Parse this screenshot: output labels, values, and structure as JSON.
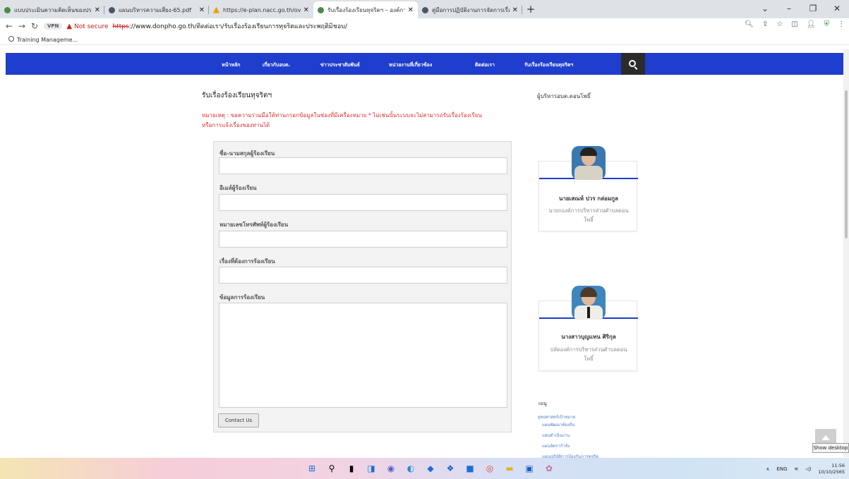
{
  "browser": {
    "tabs": [
      {
        "title": "แบบประเมินความคิดเห็นของประชาช",
        "icon": "globe-green"
      },
      {
        "title": "แผนบริหารความเสี่ยง-65.pdf",
        "icon": "globe"
      },
      {
        "title": "https://e-plan.nacc.go.th/overvie",
        "icon": "warning"
      },
      {
        "title": "รับเรื่องร้องเรียนทุจริตฯ – องค์การบริห",
        "icon": "globe-green"
      },
      {
        "title": "คู่มือการปฏิบัติงานการจัดการเรื่องร้อง",
        "icon": "globe"
      }
    ],
    "new_tab": "+",
    "address": {
      "vpn": "VPN",
      "not_secure": "Not secure",
      "scheme": "https",
      "rest": "://www.donpho.go.th/ติดต่อเรา/รับเรื่องร้องเรียนการทุจริตและประพฤติมิชอบ/"
    },
    "bookmark": "Training Manageme..."
  },
  "site_nav": {
    "items": [
      "หน้าหลัก",
      "เกี่ยวกับอบต.",
      "ข่าวประชาสัมพันธ์",
      "หน่วยงานที่เกี่ยวข้อง",
      "ติดต่อเรา",
      "รับเรื่องร้องเรียนทุจริตฯ"
    ]
  },
  "main": {
    "title": "รับเรื่องร้องเรียนทุจริตฯ",
    "notice_line1": "หมายเหตุ : ขอความร่วมมือให้ท่านกรอกข้อมูลในช่องที่มีเครื่องหมาย * ไม่เช่นนั้นระบบจะไม่สามารถรับเรื่องร้องเรียน",
    "notice_line2": "หรือการแจ้งเรื่องของท่านได้",
    "form": {
      "name_label": "ชื่อ-นามสกุลผู้ร้องเรียน",
      "email_label": "อีเมล์ผู้ร้องเรียน",
      "phone_label": "หมายเลขโทรศัพท์ผู้ร้องเรียน",
      "subject_label": "เรื่องที่ต้องการร้องเรียน",
      "detail_label": "ข้อมูลการร้องเรียน",
      "submit": "Contact Us"
    }
  },
  "sidebar": {
    "title": "ผู้บริหารอบต.ดอนโพธิ์",
    "people": [
      {
        "name": "นายเสณห์ ปวร กล่อมกูล",
        "position": "นายกองค์การบริหารส่วนตำบลดอนโพธิ์"
      },
      {
        "name": "นางสาวบุญแทน ศิริกุล",
        "position": "ปลัดองค์การบริหารส่วนตำบลดอนโพธิ์"
      }
    ],
    "menu_heading": "เมนู",
    "menu_links": [
      "ยุทธศาสตร์เป้าหมาย",
      "แผนพัฒนาท้องถิ่น",
      "แผนดำเนินงาน",
      "แผนอัตรากำลัง",
      "แผนปฏิบัติการป้องกันการทุจริต"
    ]
  },
  "tooltip": "Show desktop",
  "taskbar": {
    "tray_lang": "ENG",
    "time": "11:56",
    "date": "10/10/2565"
  }
}
